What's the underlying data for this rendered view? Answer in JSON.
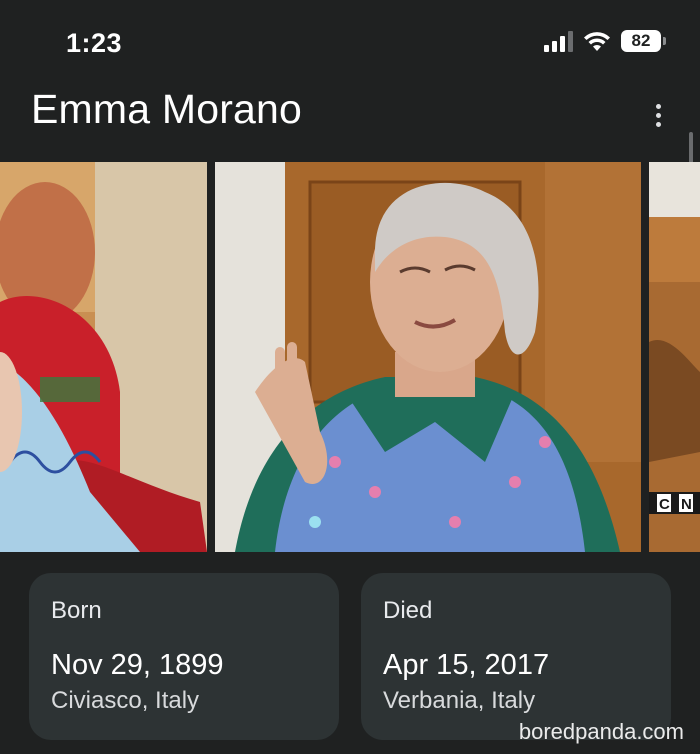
{
  "status_bar": {
    "time": "1:23",
    "battery": "82",
    "icons": [
      "signal-icon",
      "wifi-icon",
      "battery-icon"
    ]
  },
  "header": {
    "title": "Emma Morano",
    "menu_icon": "more-vert-icon"
  },
  "gallery": {
    "photo_3_overlay_text": "CN"
  },
  "facts": {
    "born": {
      "label": "Born",
      "date": "Nov 29, 1899",
      "place": "Civiasco, Italy"
    },
    "died": {
      "label": "Died",
      "date": "Apr 15, 2017",
      "place": "Verbania, Italy"
    }
  },
  "watermark": "boredpanda.com",
  "colors": {
    "background": "#1f2121",
    "card": "#2d3334",
    "text": "#ffffff"
  }
}
